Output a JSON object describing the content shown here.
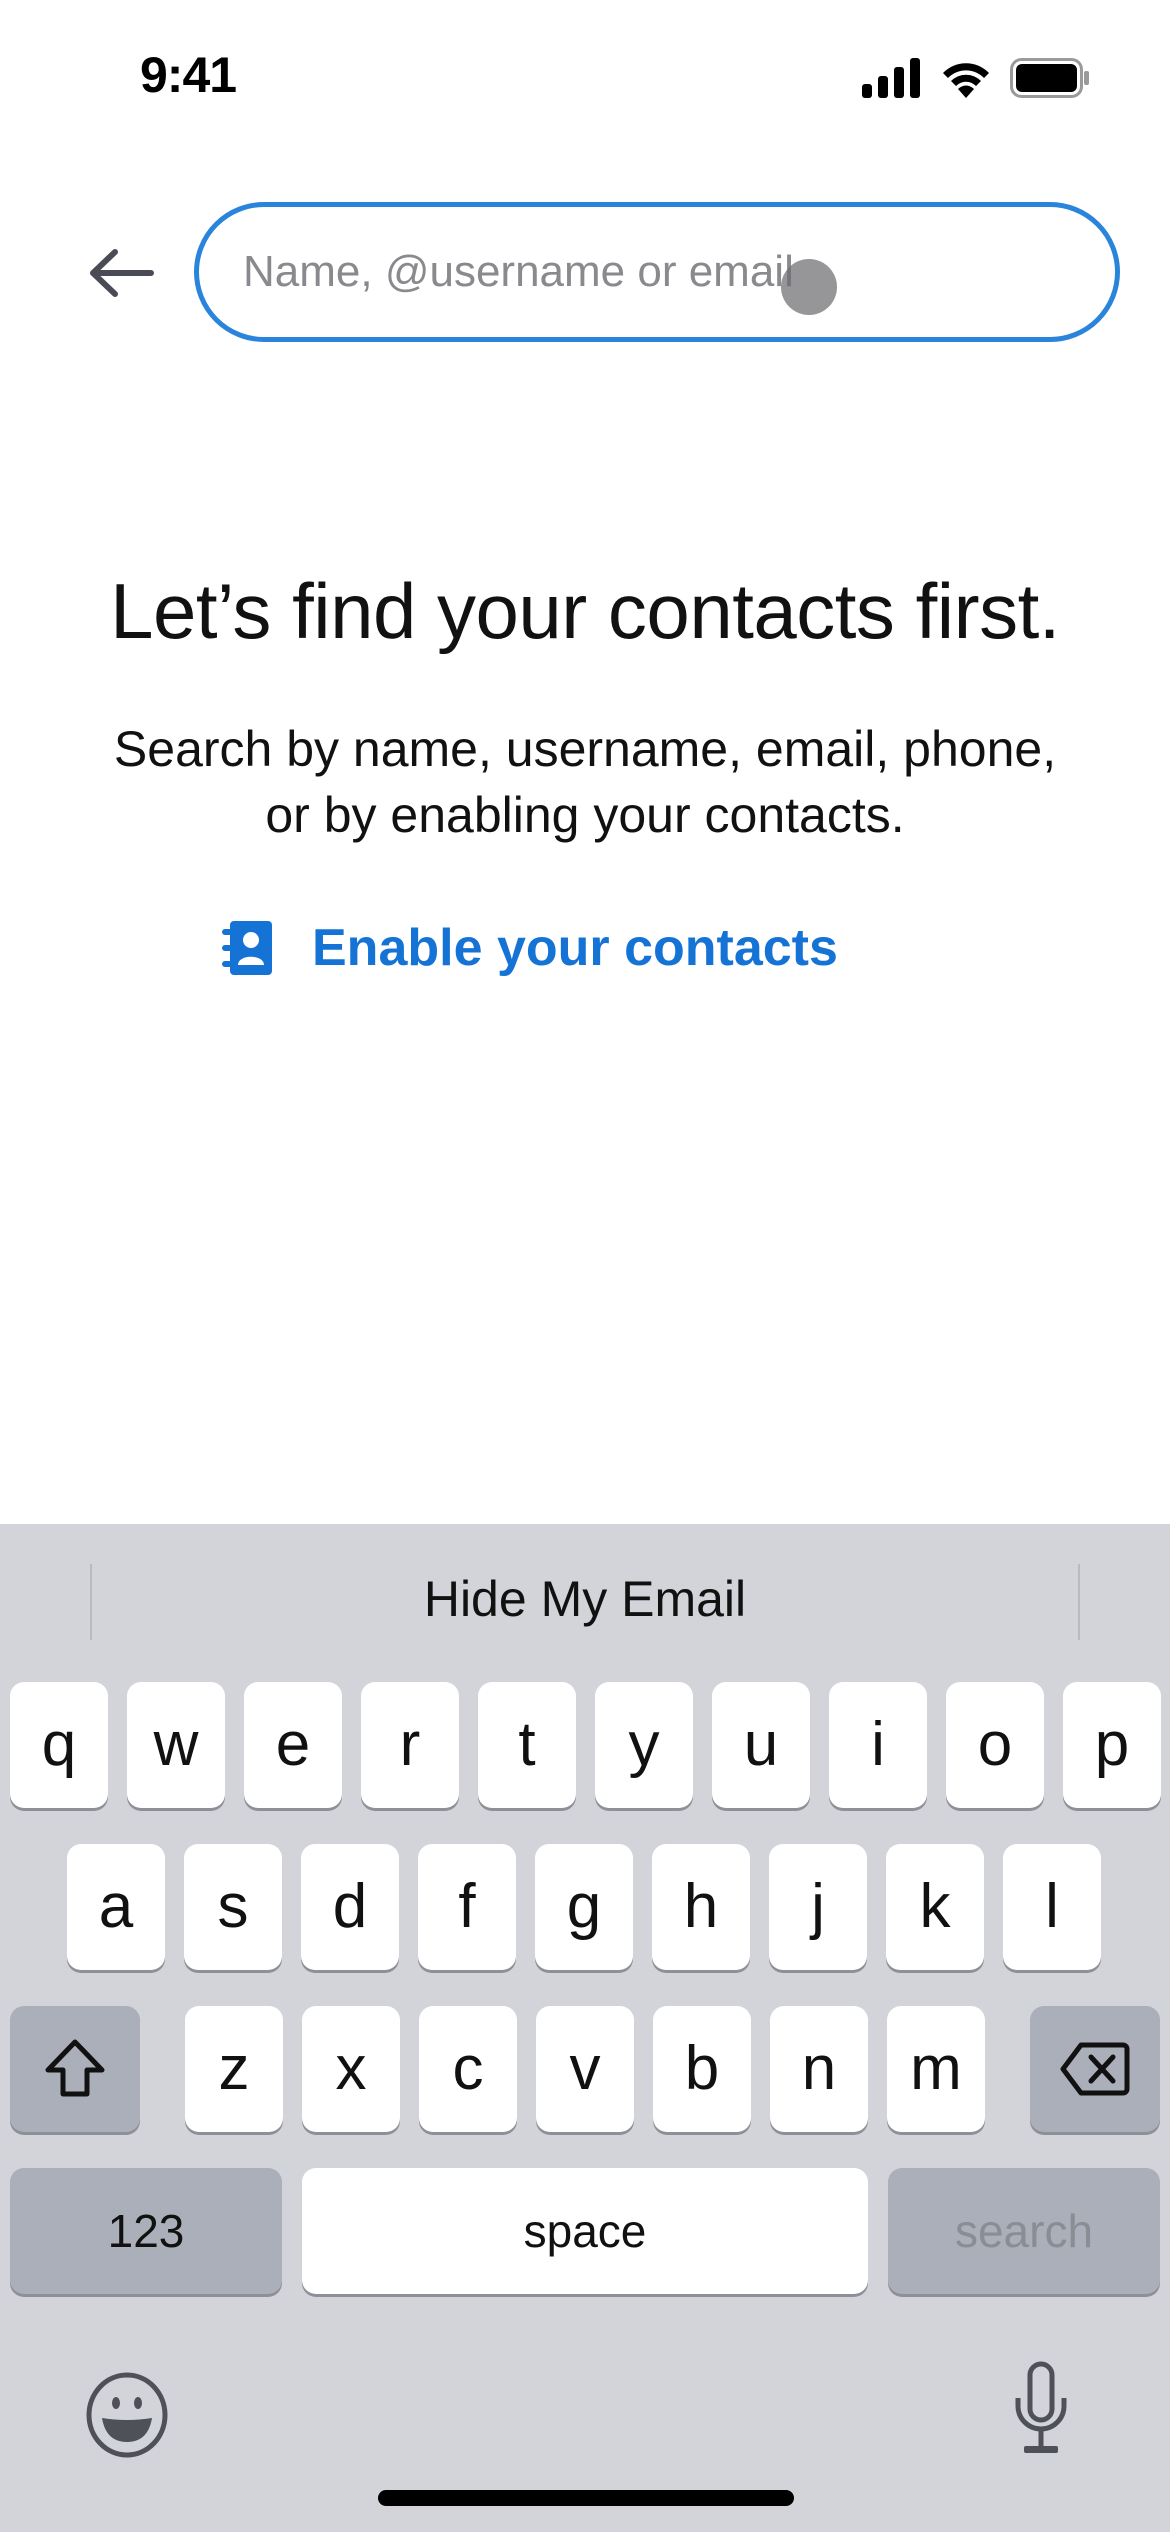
{
  "status_bar": {
    "time": "9:41",
    "icons": [
      "cellular-signal-icon",
      "wifi-icon",
      "battery-icon"
    ]
  },
  "header": {
    "back_icon": "arrow-left-icon",
    "search": {
      "value": "",
      "placeholder": "Name, @username or email"
    }
  },
  "main": {
    "headline": "Let’s find your contacts first.",
    "subtext_line1": "Search by name, username, email, phone,",
    "subtext_line2": "or by enabling your contacts.",
    "enable_contacts": {
      "icon": "contacts-book-icon",
      "label": "Enable your contacts"
    }
  },
  "colors": {
    "accent": "#1673d6",
    "search_border": "#2a84db",
    "keyboard_bg": "#d2d4d9",
    "key_dark": "#abafb9"
  },
  "keyboard": {
    "suggestion": "Hide My Email",
    "row1": [
      "q",
      "w",
      "e",
      "r",
      "t",
      "y",
      "u",
      "i",
      "o",
      "p"
    ],
    "row2": [
      "a",
      "s",
      "d",
      "f",
      "g",
      "h",
      "j",
      "k",
      "l"
    ],
    "row3": [
      "z",
      "x",
      "c",
      "v",
      "b",
      "n",
      "m"
    ],
    "shift_icon": "shift-icon",
    "delete_icon": "delete-backspace-icon",
    "numbers_label": "123",
    "space_label": "space",
    "return_label": "search",
    "emoji_icon": "emoji-icon",
    "mic_icon": "microphone-icon"
  }
}
